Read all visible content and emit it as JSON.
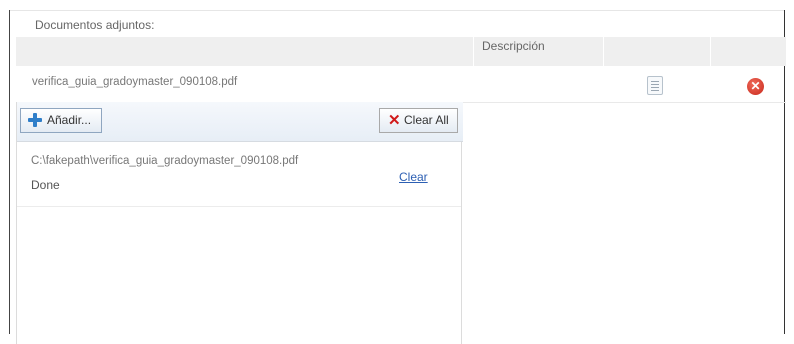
{
  "section": {
    "title": "Documentos adjuntos:"
  },
  "table": {
    "headers": [
      "",
      "Descripción",
      "",
      ""
    ],
    "rows": [
      {
        "file_name": "verifica_guia_gradoymaster_090108.pdf"
      }
    ]
  },
  "icons": {
    "view": "document-view-icon",
    "delete": "delete-x-icon",
    "add": "plus-icon",
    "clear_all": "x-icon"
  },
  "uploader": {
    "add_label": "Añadir...",
    "clear_all_label": "Clear All",
    "queue": [
      {
        "path": "C:\\fakepath\\verifica_guia_gradoymaster_090108.pdf",
        "status": "Done",
        "clear_label": "Clear"
      }
    ]
  },
  "colors": {
    "header_bg": "#efefef",
    "link": "#2c5fb3",
    "delete_red": "#c8291c",
    "add_blue": "#2f7ec9"
  }
}
